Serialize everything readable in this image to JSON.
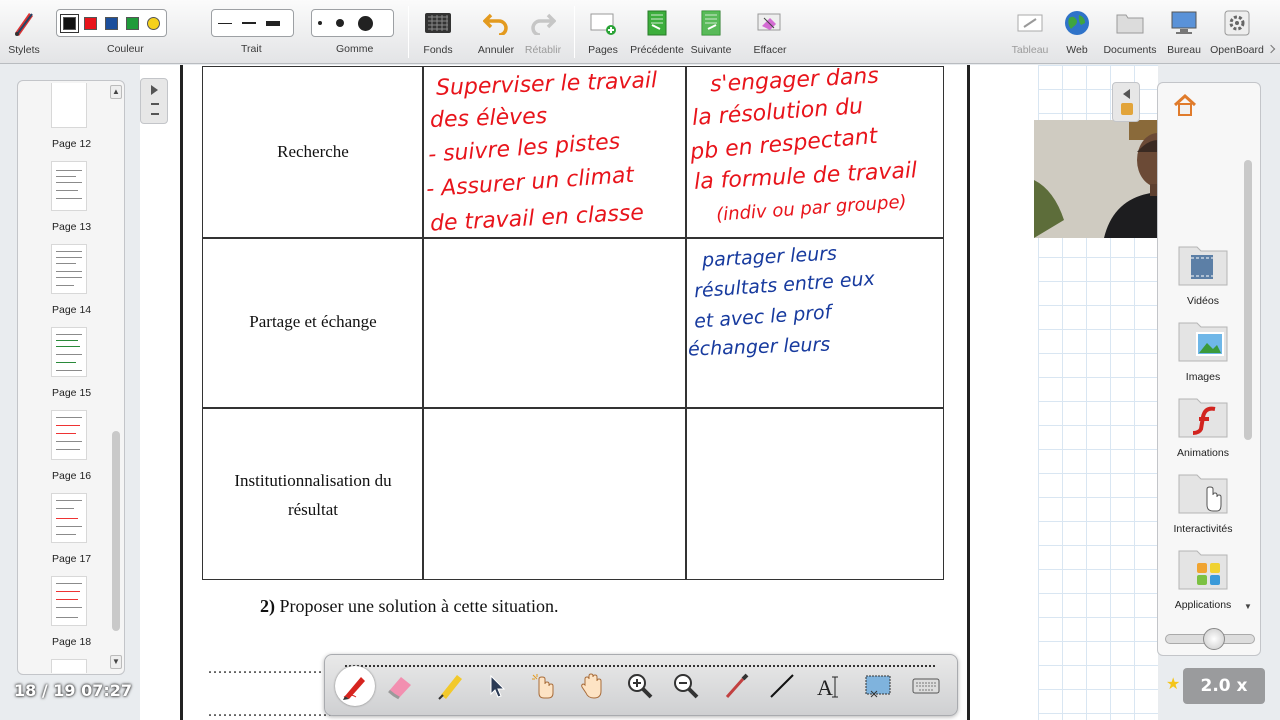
{
  "toolbar": {
    "stylets": "Stylets",
    "couleur": "Couleur",
    "trait": "Trait",
    "gomme": "Gomme",
    "fonds": "Fonds",
    "annuler": "Annuler",
    "retablir": "Rétablir",
    "pages": "Pages",
    "precedente": "Précédente",
    "suivante": "Suivante",
    "effacer": "Effacer",
    "tableau": "Tableau",
    "web": "Web",
    "documents": "Documents",
    "bureau": "Bureau",
    "openboard": "OpenBoard",
    "colors": [
      "#111111",
      "#e8141b",
      "#1c4f9c",
      "#1f9b3a",
      "#f5d11c"
    ]
  },
  "thumbnails": {
    "pages": [
      "Page 12",
      "Page 13",
      "Page 14",
      "Page 15",
      "Page 16",
      "Page 17",
      "Page 18"
    ],
    "counter": "18 / 19 07:27"
  },
  "document": {
    "rows": [
      "Recherche",
      "Partage et échange",
      "Institutionnalisation du résultat"
    ],
    "question_num": "2)",
    "question_text": " Proposer une solution à cette situation.",
    "dots": "..........................................................................................................."
  },
  "handwriting": {
    "red_lines": [
      "Superviser le travail",
      "des élèves",
      "- suivre les pistes",
      "- Assurer un climat",
      "de travail en classe",
      "s'engager dans",
      "la résolution du",
      "pb en respectant",
      "la formule de travail",
      "(indiv ou par groupe)"
    ],
    "blue_lines": [
      "partager leurs",
      "résultats entre eux",
      "et avec le prof",
      "échanger leurs"
    ]
  },
  "library": {
    "items": [
      "Vidéos",
      "Images",
      "Animations",
      "Interactivités",
      "Applications"
    ]
  },
  "zoom": "2.0 x"
}
